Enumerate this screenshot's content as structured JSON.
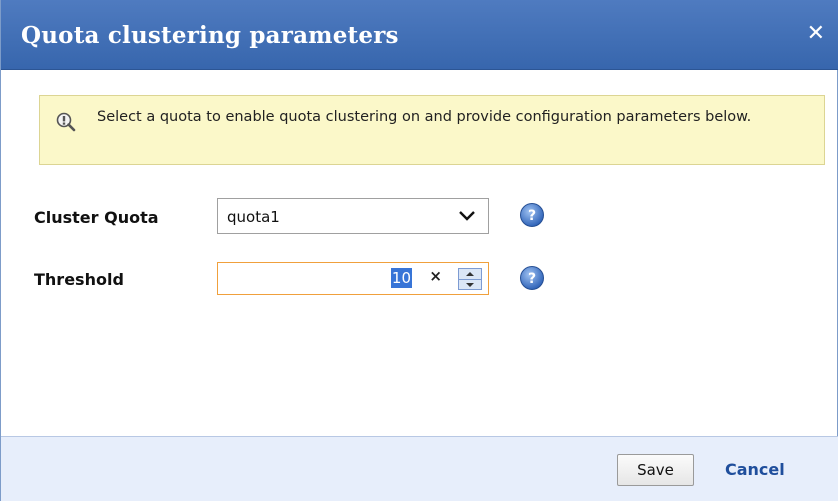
{
  "dialog": {
    "title": "Quota clustering parameters",
    "close_icon": "close-icon"
  },
  "info": {
    "icon": "info-magnifier-icon",
    "message": "Select a quota to enable quota clustering on and provide configuration parameters below."
  },
  "form": {
    "cluster_quota": {
      "label": "Cluster Quota",
      "value": "quota1",
      "icon": "chevron-down-icon",
      "help_icon": "help-icon"
    },
    "threshold": {
      "label": "Threshold",
      "value": "10",
      "clear_label": "×",
      "help_icon": "help-icon"
    }
  },
  "footer": {
    "save_label": "Save",
    "cancel_label": "Cancel"
  },
  "colors": {
    "title_bar": "#3f6fb7",
    "info_background": "#fbf8c9",
    "footer_background": "#e7eefb",
    "focus_border": "#f0a03c",
    "selection": "#3875d7",
    "link": "#1f4e9c"
  }
}
